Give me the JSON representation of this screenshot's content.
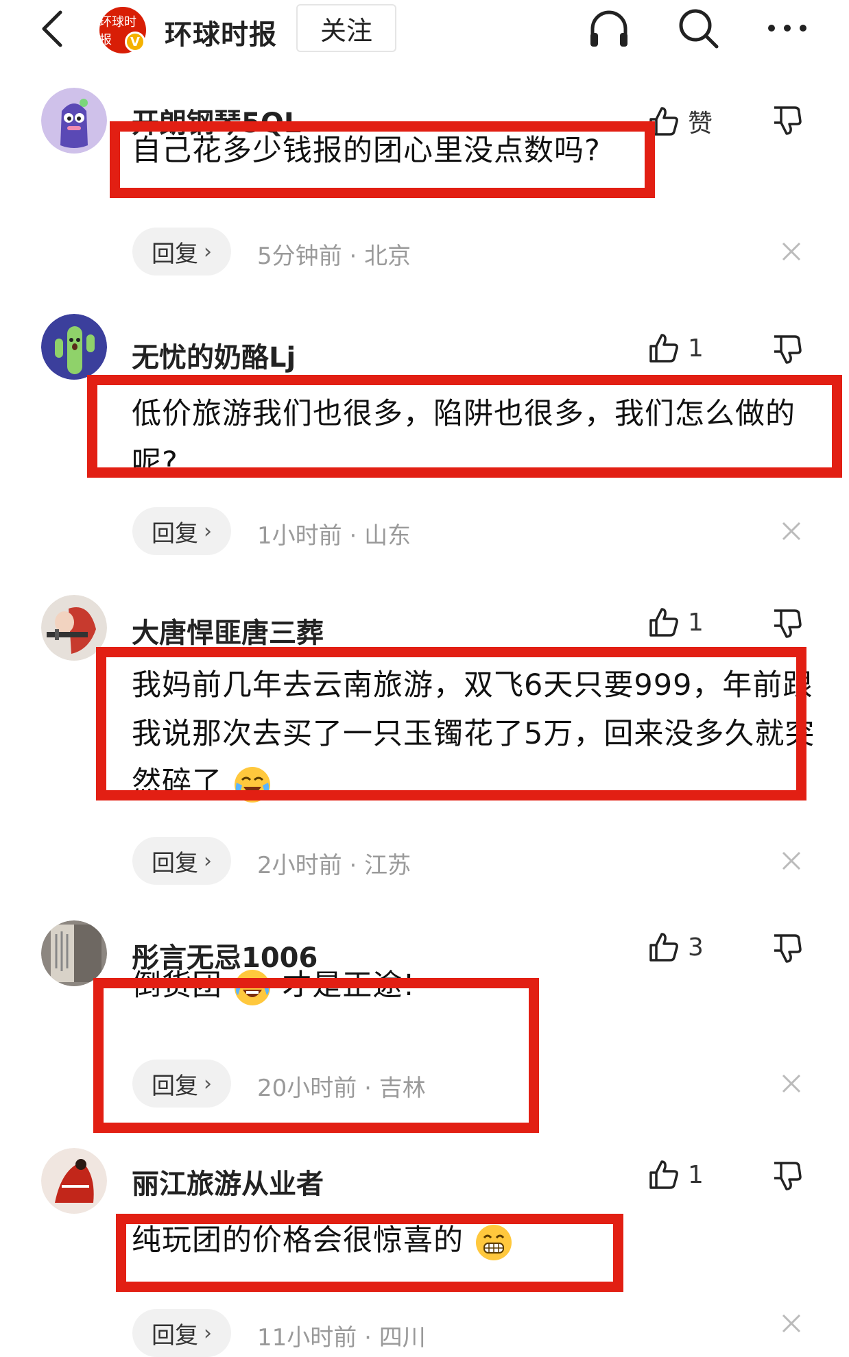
{
  "header": {
    "channel_name": "环球时报",
    "logo_text": "环球时报",
    "verified_badge": "V",
    "follow_label": "关注",
    "icons": [
      "back-icon",
      "headphones-icon",
      "search-icon",
      "more-icon"
    ]
  },
  "comments": [
    {
      "user": "开朗钢琴5QL",
      "like": "赞",
      "text": "自己花多少钱报的团心里没点数吗?",
      "reply": "回复",
      "time": "5分钟前",
      "location": "北京"
    },
    {
      "user": "无忧的奶酪Lj",
      "like": "1",
      "text": "低价旅游我们也很多，陷阱也很多，我们怎么做的呢?",
      "reply": "回复",
      "time": "1小时前",
      "location": "山东"
    },
    {
      "user": "大唐悍匪唐三葬",
      "like": "1",
      "text": "我妈前几年去云南旅游，双飞6天只要999，年前跟我说那次去买了一只玉镯花了5万，回来没多久就突然碎了",
      "reply": "回复",
      "time": "2小时前",
      "location": "江苏"
    },
    {
      "user": "彤言无忌1006",
      "like": "3",
      "text_before": "倒货团",
      "text_after": "才是正途!",
      "reply": "回复",
      "time": "20小时前",
      "location": "吉林"
    },
    {
      "user": "丽江旅游从业者",
      "like": "1",
      "text": "纯玩团的价格会很惊喜的",
      "reply": "回复",
      "time": "11小时前",
      "location": "四川"
    }
  ],
  "colors": {
    "highlight": "#e21f13",
    "meta": "#9a9a9a",
    "logo": "#d81e06"
  }
}
